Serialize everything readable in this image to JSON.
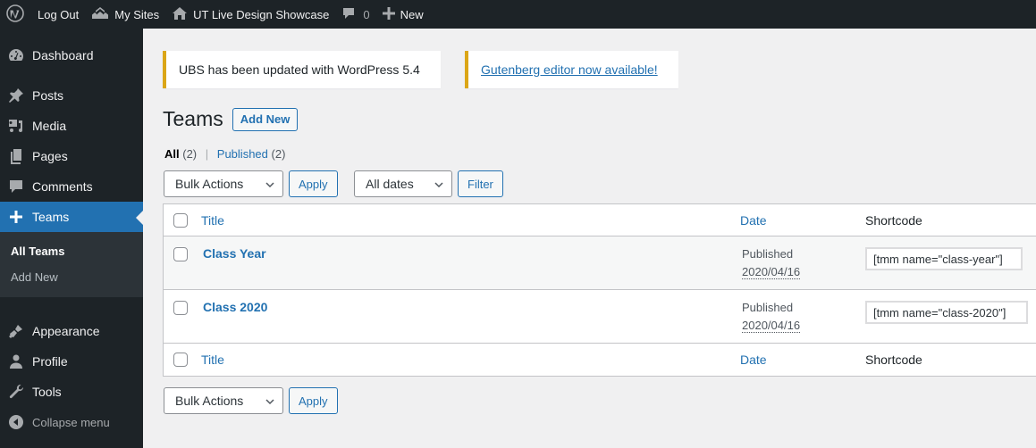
{
  "adminbar": {
    "wp_icon": "wordpress-logo-icon",
    "logout": "Log Out",
    "my_sites": "My Sites",
    "site_name": "UT Live Design Showcase",
    "comments_count": "0",
    "new_label": "New"
  },
  "sidebar": {
    "items": [
      {
        "label": "Dashboard",
        "icon": "dashboard-icon"
      },
      {
        "label": "Posts",
        "icon": "pin-icon"
      },
      {
        "label": "Media",
        "icon": "media-icon"
      },
      {
        "label": "Pages",
        "icon": "pages-icon"
      },
      {
        "label": "Comments",
        "icon": "comment-icon"
      },
      {
        "label": "Teams",
        "icon": "plus-icon"
      },
      {
        "label": "Appearance",
        "icon": "brush-icon"
      },
      {
        "label": "Profile",
        "icon": "user-icon"
      },
      {
        "label": "Tools",
        "icon": "wrench-icon"
      },
      {
        "label": "Collapse menu",
        "icon": "collapse-icon"
      }
    ],
    "submenu": [
      {
        "label": "All Teams"
      },
      {
        "label": "Add New"
      }
    ]
  },
  "notices": {
    "update": "UBS has been updated with WordPress 5.4",
    "gutenberg": "Gutenberg editor now available!"
  },
  "page": {
    "title": "Teams",
    "add_new": "Add New"
  },
  "filters": {
    "all_label": "All",
    "all_count": "(2)",
    "separator": "|",
    "published_label": "Published",
    "published_count": "(2)",
    "bulk_actions": "Bulk Actions",
    "apply": "Apply",
    "dates": "All dates",
    "filter": "Filter"
  },
  "table": {
    "columns": {
      "title": "Title",
      "date": "Date",
      "shortcode": "Shortcode"
    },
    "rows": [
      {
        "title": "Class Year",
        "status": "Published",
        "date": "2020/04/16",
        "shortcode": "[tmm name=\"class-year\"]"
      },
      {
        "title": "Class 2020",
        "status": "Published",
        "date": "2020/04/16",
        "shortcode": "[tmm name=\"class-2020\"]"
      }
    ]
  },
  "colors": {
    "accent": "#2271b1",
    "notice_warning": "#dba617",
    "adminbar_bg": "#1d2327"
  }
}
